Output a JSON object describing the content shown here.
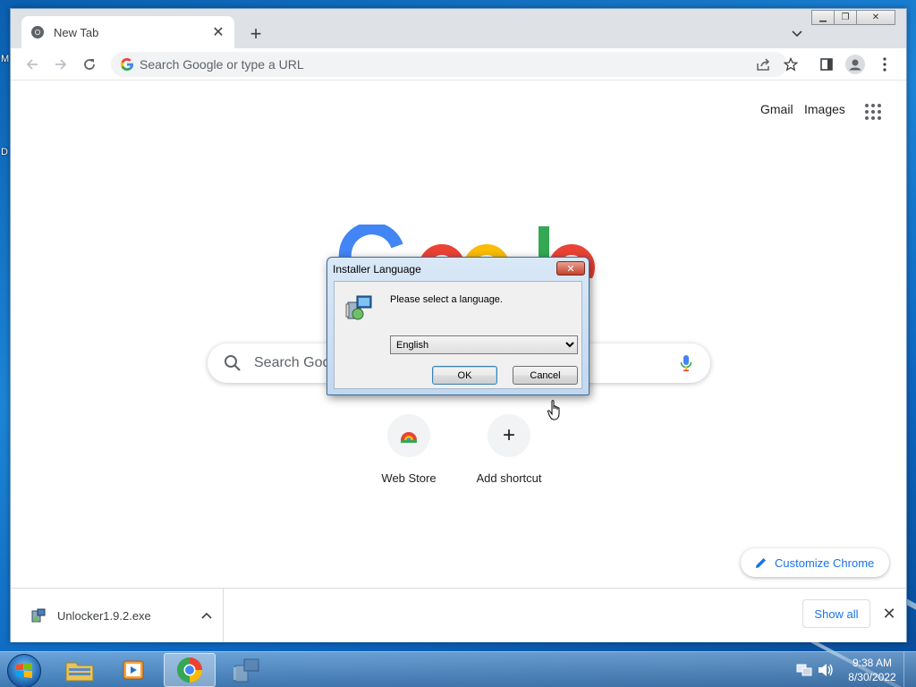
{
  "desktop": {
    "fragment_1": "M",
    "fragment_2": "D"
  },
  "chrome": {
    "tab": {
      "title": "New Tab"
    },
    "omnibox": {
      "placeholder": "Search Google or type a URL"
    },
    "ntp": {
      "gmail": "Gmail",
      "images": "Images",
      "search_placeholder": "Search Google or type a URL",
      "shortcuts": [
        {
          "label": "Web Store"
        },
        {
          "label": "Add shortcut"
        }
      ],
      "customize": "Customize Chrome"
    },
    "downloads": {
      "file": "Unlocker1.9.2.exe",
      "show_all": "Show all"
    }
  },
  "dialog": {
    "title": "Installer Language",
    "message": "Please select a language.",
    "language_options": [
      "English"
    ],
    "selected_language": "English",
    "ok": "OK",
    "cancel": "Cancel"
  },
  "taskbar": {
    "time": "9:38 AM",
    "date": "8/30/2022"
  },
  "colors": {
    "google_blue": "#4285F4",
    "google_red": "#EA4335",
    "google_yellow": "#FBBC05",
    "google_green": "#34A853",
    "link_blue": "#1a73e8"
  }
}
